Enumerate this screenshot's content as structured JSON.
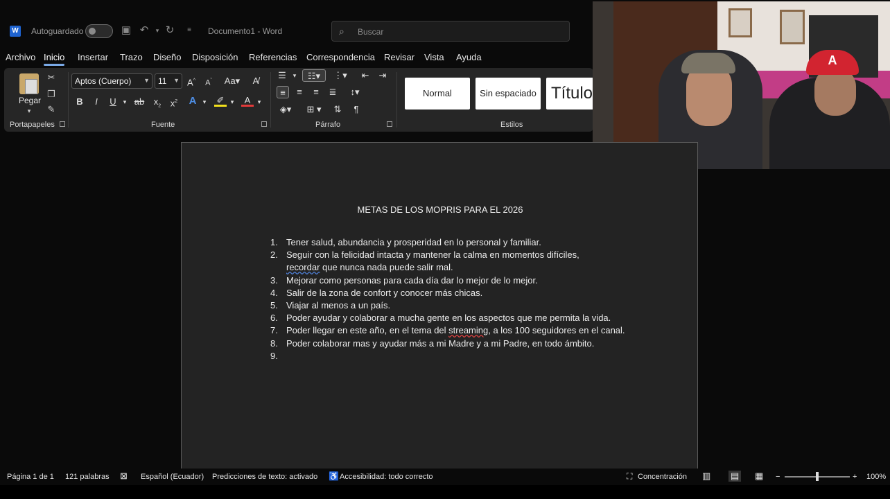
{
  "titlebar": {
    "autosave_label": "Autoguardado",
    "doc_title": "Documento1  -  Word",
    "search_placeholder": "Buscar"
  },
  "tabs": [
    "Archivo",
    "Inicio",
    "Insertar",
    "Trazo",
    "Diseño",
    "Disposición",
    "Referencias",
    "Correspondencia",
    "Revisar",
    "Vista",
    "Ayuda"
  ],
  "ribbon": {
    "clipboard": {
      "paste_label": "Pegar",
      "group_label": "Portapapeles"
    },
    "font": {
      "font_name": "Aptos (Cuerpo)",
      "font_size": "11",
      "group_label": "Fuente"
    },
    "paragraph": {
      "group_label": "Párrafo"
    },
    "styles": {
      "items": [
        "Normal",
        "Sin espaciado",
        "Título"
      ],
      "group_label": "Estilos"
    }
  },
  "document": {
    "heading": "METAS DE LOS MOPRIS PARA EL 2026",
    "goals": [
      {
        "num": "1.",
        "text": "Tener salud, abundancia y prosperidad en lo personal y familiar."
      },
      {
        "num": "2.",
        "text_a": "Seguir con la felicidad intacta y mantener la calma en momentos difíciles,",
        "text_b_word": "recordar",
        "text_b_rest": " que nunca nada puede salir mal."
      },
      {
        "num": "3.",
        "text": "Mejorar como personas para cada día dar lo mejor de lo mejor."
      },
      {
        "num": "4.",
        "text": "Salir de la zona de confort y conocer más chicas."
      },
      {
        "num": "5.",
        "text": "Viajar al menos a un país."
      },
      {
        "num": "6.",
        "text": "Poder ayudar y colaborar a mucha gente en los aspectos que me permita la vida."
      },
      {
        "num": "7.",
        "text_pre": "Poder llegar en este año, en el tema del ",
        "text_word": "streaming",
        "text_post": ", a los 100 seguidores en el canal."
      },
      {
        "num": "8.",
        "text": "Poder colaborar mas y ayudar más a mi Madre y a mi Padre, en todo ámbito."
      },
      {
        "num": "9.",
        "text": ""
      }
    ]
  },
  "statusbar": {
    "page": "Página 1 de 1",
    "words": "121 palabras",
    "language": "Español (Ecuador)",
    "predictions": "Predicciones de texto: activado",
    "accessibility": "Accesibilidad: todo correcto",
    "focus": "Concentración",
    "zoom": "100%"
  },
  "webcam": {
    "cap_logo": "A"
  }
}
